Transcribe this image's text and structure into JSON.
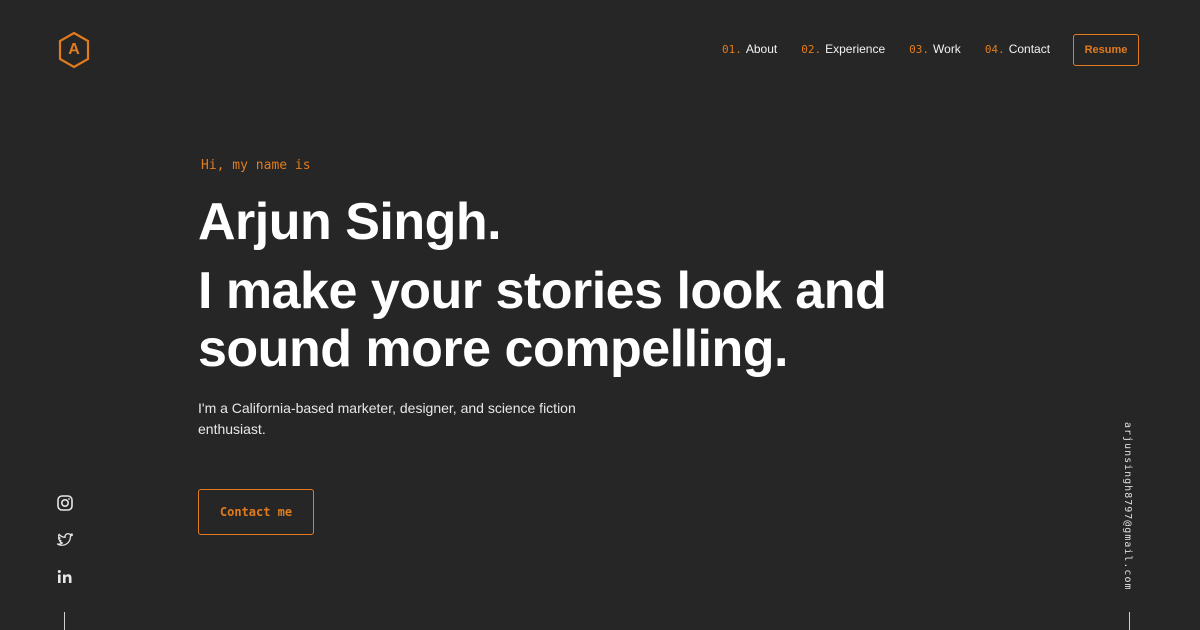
{
  "logo": {
    "letter": "A",
    "icon": "hexagon-logo-icon"
  },
  "nav": {
    "items": [
      {
        "num": "01.",
        "label": "About"
      },
      {
        "num": "02.",
        "label": "Experience"
      },
      {
        "num": "03.",
        "label": "Work"
      },
      {
        "num": "04.",
        "label": "Contact"
      }
    ],
    "resume_label": "Resume"
  },
  "hero": {
    "greeting": "Hi, my name is",
    "name": "Arjun Singh.",
    "tagline": "I make your stories look and sound more compelling.",
    "bio": "I'm a California-based marketer, designer, and science fiction enthusiast.",
    "cta_label": "Contact me"
  },
  "socials": [
    {
      "icon": "instagram-icon"
    },
    {
      "icon": "twitter-icon"
    },
    {
      "icon": "linkedin-icon"
    }
  ],
  "email": "arjunsingh8797@gmail.com",
  "colors": {
    "background": "#262626",
    "accent": "#e07b1f",
    "text": "#ffffff"
  }
}
